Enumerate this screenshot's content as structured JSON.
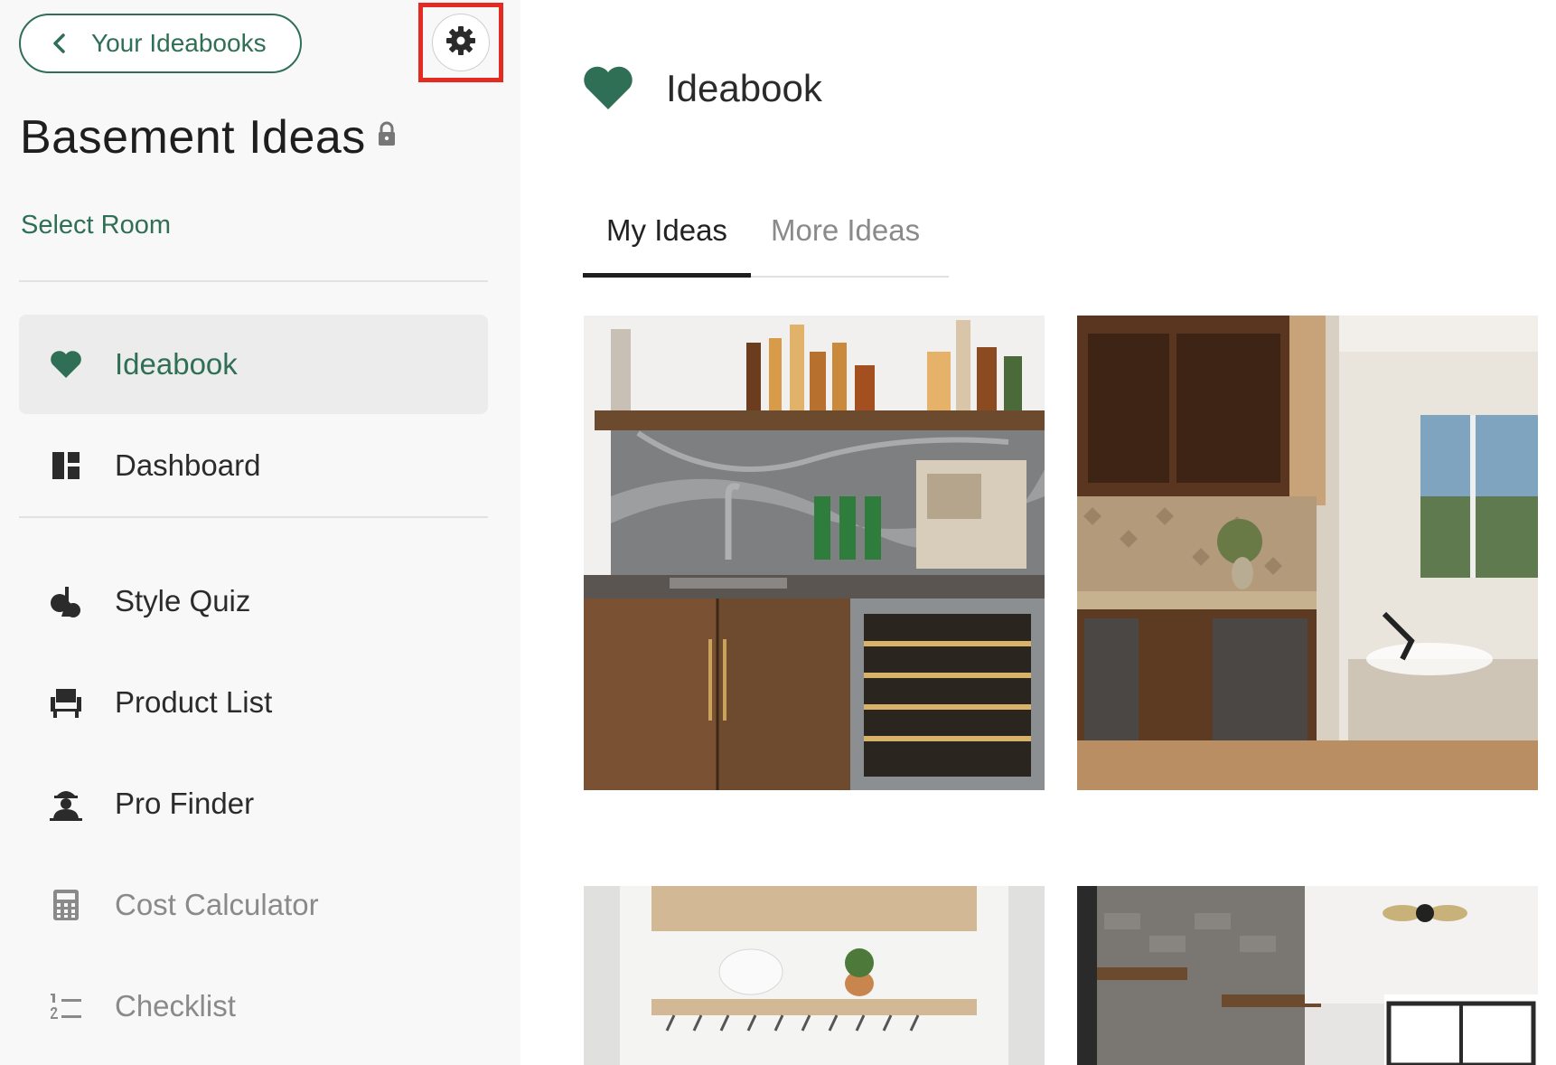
{
  "sidebar": {
    "back_label": "Your Ideabooks",
    "title": "Basement Ideas",
    "select_room": "Select Room",
    "nav": [
      {
        "label": "Ideabook",
        "icon": "heart-icon"
      },
      {
        "label": "Dashboard",
        "icon": "dashboard-icon"
      },
      {
        "label": "Style Quiz",
        "icon": "style-quiz-icon"
      },
      {
        "label": "Product List",
        "icon": "armchair-icon"
      },
      {
        "label": "Pro Finder",
        "icon": "pro-finder-icon"
      },
      {
        "label": "Cost Calculator",
        "icon": "calculator-icon"
      },
      {
        "label": "Checklist",
        "icon": "checklist-icon"
      }
    ]
  },
  "main": {
    "title": "Ideabook",
    "tabs": [
      {
        "label": "My Ideas"
      },
      {
        "label": "More Ideas"
      }
    ]
  },
  "colors": {
    "brand_green": "#2f6f55",
    "highlight_red": "#e32b22",
    "sidebar_bg": "#f8f8f8"
  }
}
